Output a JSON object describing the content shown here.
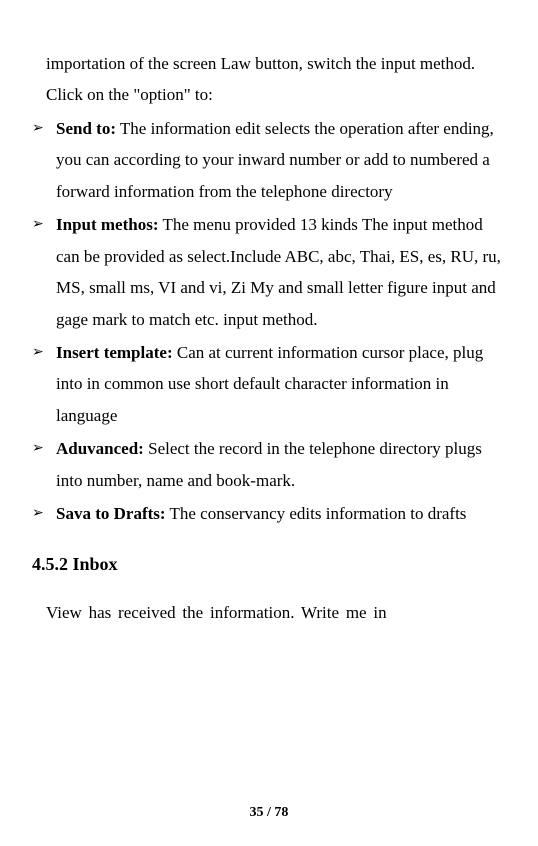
{
  "intro": "importation of the screen Law button, switch the input method. Click on the \"option\" to:",
  "bullets": [
    {
      "label": "Send to:",
      "text": " The information edit selects the operation after ending, you can according to your inward number or add to numbered a forward information from the telephone directory"
    },
    {
      "label": "Input methos:",
      "text": " The menu provided 13 kinds The input method can be provided as select.Include ABC, abc, Thai, ES, es, RU, ru, MS, small ms, VI and vi, Zi My and small letter figure input and gage mark to match etc. input method."
    },
    {
      "label": "Insert template:",
      "text": " Can at current information cursor place, plug into in common use short default character information in language"
    },
    {
      "label": "Aduvanced:",
      "text": " Select the record in the telephone directory plugs into number, name and book-mark."
    },
    {
      "label": "Sava to Drafts:",
      "text": " The conservancy edits information to drafts"
    }
  ],
  "section": {
    "heading": "4.5.2 Inbox",
    "para": "View has received the information. Write me in"
  },
  "footer": "35 / 78"
}
